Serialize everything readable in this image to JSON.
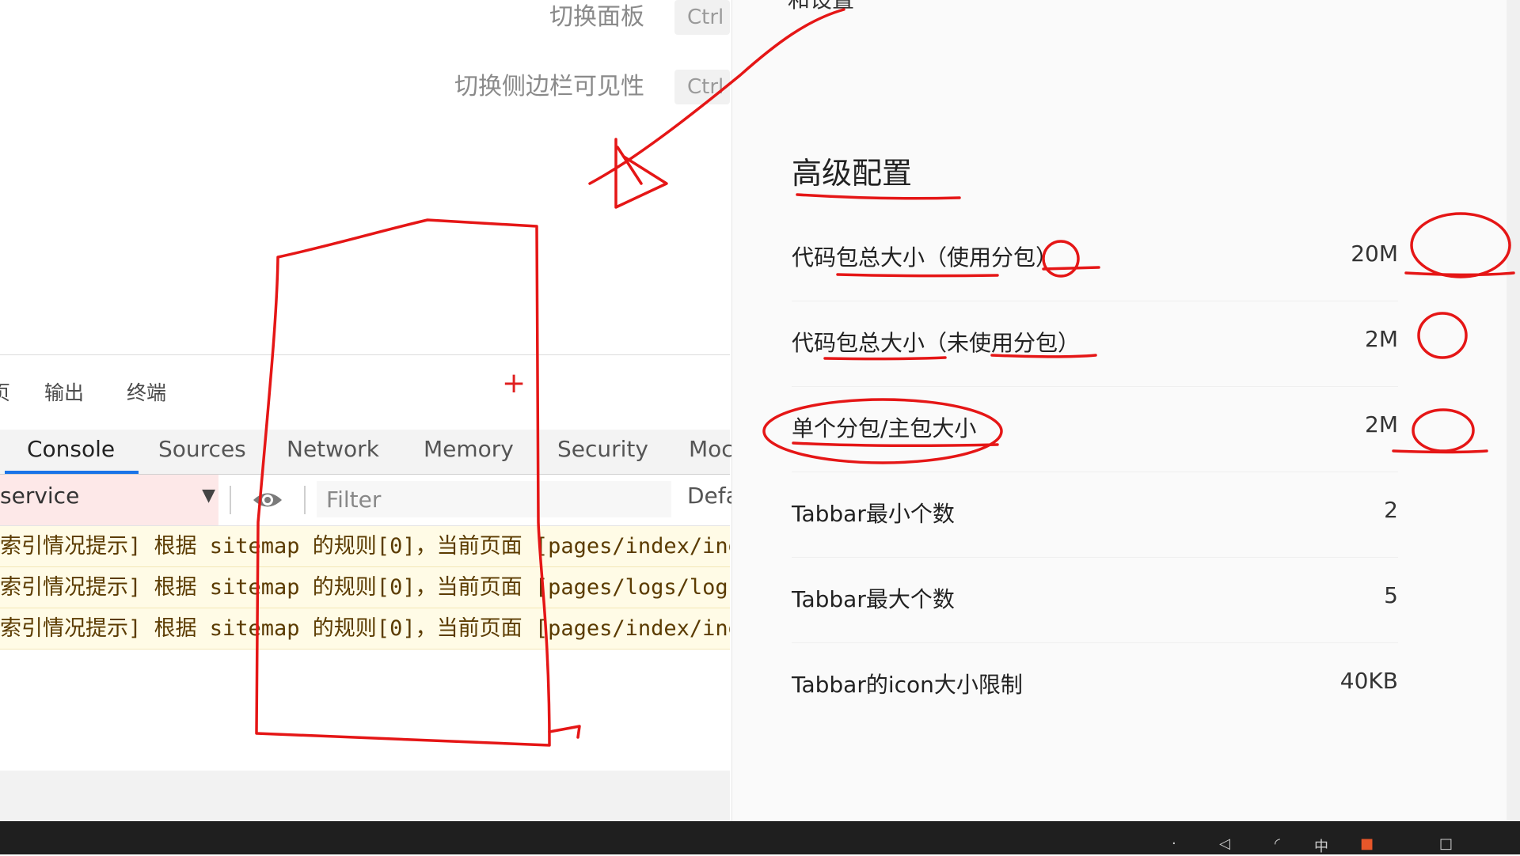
{
  "shortcuts": [
    {
      "label": "切换面板",
      "key": "Ctrl"
    },
    {
      "label": "切换侧边栏可见性",
      "key": "Ctrl"
    }
  ],
  "devtools": {
    "panel_tabs": [
      "页",
      "输出",
      "终端"
    ],
    "tabs": [
      "Console",
      "Sources",
      "Network",
      "Memory",
      "Security",
      "Moc"
    ],
    "context": "service",
    "filter_placeholder": "Filter",
    "levels": "Defa",
    "logs": [
      "索引情况提示] 根据 sitemap 的规则[0]，当前页面 [pages/index/index",
      "索引情况提示] 根据 sitemap 的规则[0]，当前页面 [pages/logs/logs",
      "索引情况提示] 根据 sitemap 的规则[0]，当前页面 [pages/index/index"
    ]
  },
  "limits": {
    "top_text": "和设置",
    "title": "高级配置",
    "rows": [
      {
        "label": "代码包总大小（使用分包）",
        "value": "20M"
      },
      {
        "label": "代码包总大小（未使用分包）",
        "value": "2M"
      },
      {
        "label": "单个分包/主包大小",
        "value": "2M"
      },
      {
        "label": "Tabbar最小个数",
        "value": "2"
      },
      {
        "label": "Tabbar最大个数",
        "value": "5"
      },
      {
        "label": "Tabbar的icon大小限制",
        "value": "40KB"
      }
    ]
  },
  "colors": {
    "annotation": "#e51616",
    "active_tab": "#1a73e8",
    "log_bg": "#fffbe6"
  }
}
